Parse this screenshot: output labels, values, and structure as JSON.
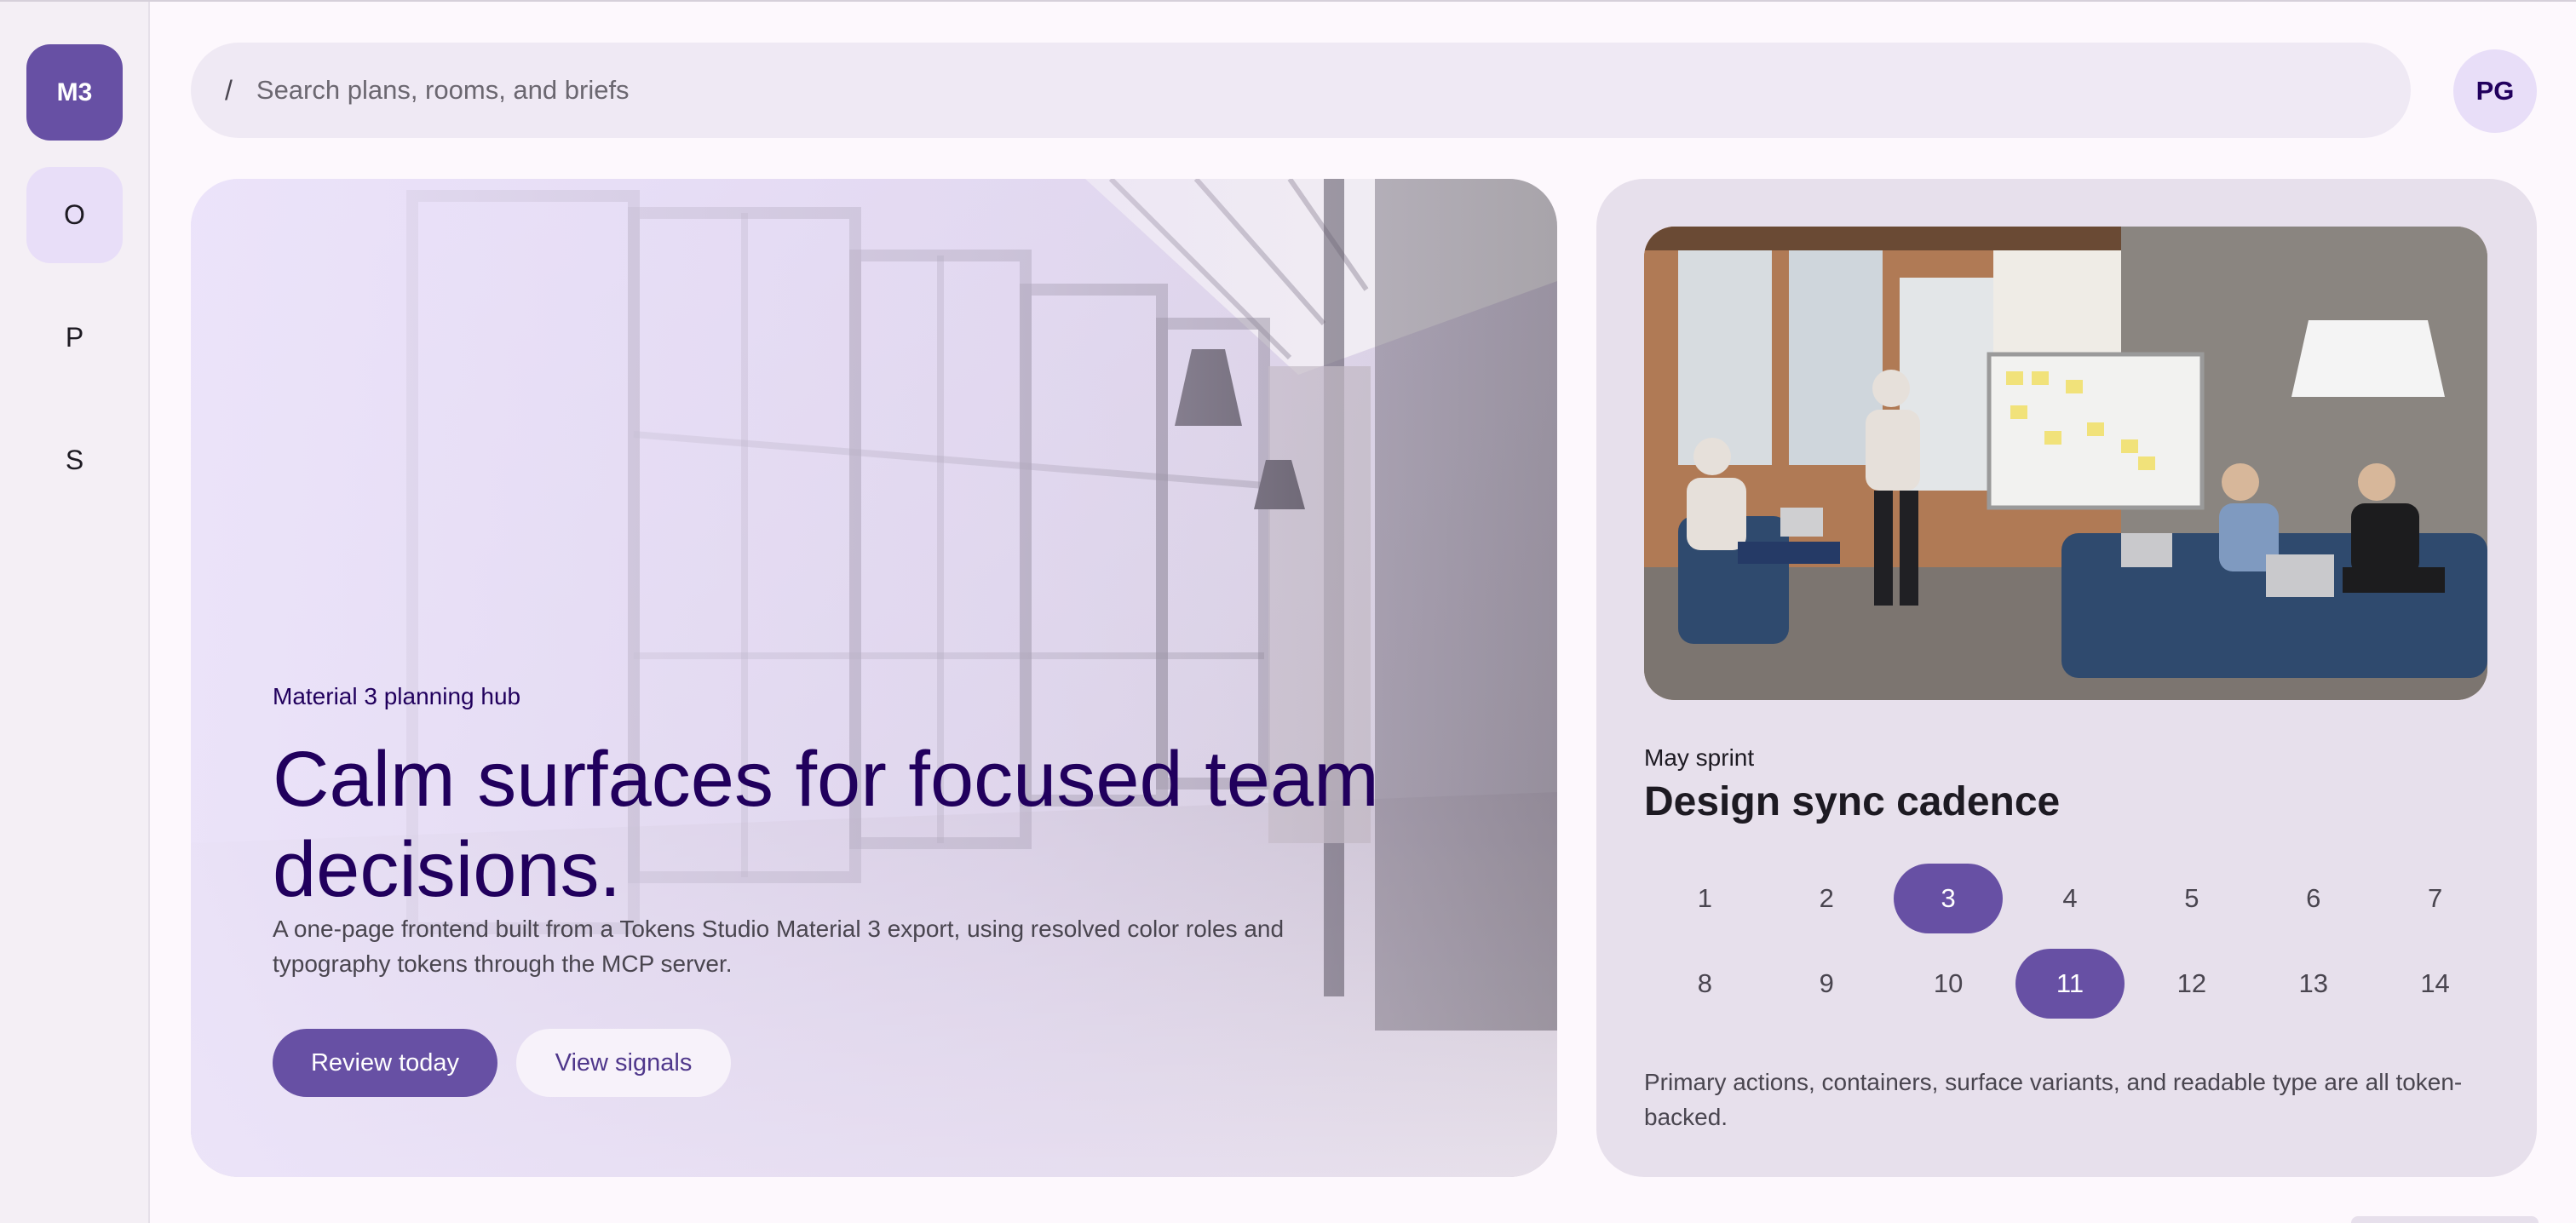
{
  "rail": {
    "items": [
      {
        "label": "M3"
      },
      {
        "label": "O"
      },
      {
        "label": "P"
      },
      {
        "label": "S"
      }
    ]
  },
  "search": {
    "prefix": "/",
    "placeholder": "Search plans, rooms, and briefs"
  },
  "profile": {
    "initials": "PG"
  },
  "hero": {
    "eyebrow": "Material 3 planning hub",
    "headline": "Calm surfaces for focused team decisions.",
    "lede": "A one-page frontend built from a Tokens Studio Material 3 export, using resolved color roles and typography tokens through the MCP server.",
    "primary_label": "Review today",
    "secondary_label": "View signals"
  },
  "sprint": {
    "eyebrow": "May sprint",
    "title": "Design sync cadence",
    "days": [
      {
        "label": "1"
      },
      {
        "label": "2"
      },
      {
        "label": "3",
        "active": true
      },
      {
        "label": "4"
      },
      {
        "label": "5"
      },
      {
        "label": "6"
      },
      {
        "label": "7"
      },
      {
        "label": "8"
      },
      {
        "label": "9"
      },
      {
        "label": "10"
      },
      {
        "label": "11",
        "active": true
      },
      {
        "label": "12"
      },
      {
        "label": "13"
      },
      {
        "label": "14"
      }
    ],
    "footnote": "Primary actions, containers, surface variants, and readable type are all token-backed."
  },
  "colors": {
    "primary": "#6750a4",
    "on_primary_container": "#21005d",
    "secondary_container": "#e8def8",
    "surface_variant": "#e7e0ec"
  },
  "icons": {
    "search_prefix": "slash"
  }
}
